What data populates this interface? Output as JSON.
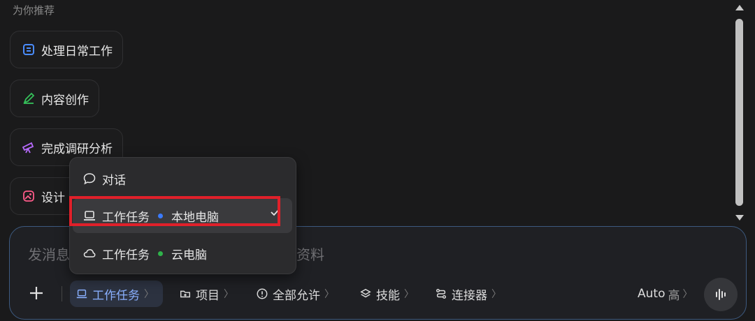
{
  "recommend": {
    "title": "为你推荐",
    "cards": [
      {
        "label": "处理日常工作",
        "icon": "doc-icon"
      },
      {
        "label": "内容创作",
        "icon": "pen-icon"
      },
      {
        "label": "完成调研分析",
        "icon": "telescope-icon"
      },
      {
        "label": "设计",
        "icon": "image-icon"
      }
    ]
  },
  "composer": {
    "placeholder_left": "发消息",
    "placeholder_right": "资料"
  },
  "toolbar": {
    "work_task": "工作任务",
    "project": "项目",
    "permission": "全部允许",
    "skills": "技能",
    "connector": "连接器",
    "mode": "Auto",
    "level": "高"
  },
  "menu": {
    "items": [
      {
        "label": "对话",
        "icon": "chat-icon"
      },
      {
        "label": "工作任务",
        "sub": "本地电脑",
        "dot": "#3b7bff",
        "icon": "laptop-icon",
        "selected": true
      },
      {
        "label": "工作任务",
        "sub": "云电脑",
        "dot": "#2fb34a",
        "icon": "cloud-icon"
      }
    ]
  },
  "colors": {
    "accent": "#8ab0ff",
    "highlight": "#e0202a"
  }
}
